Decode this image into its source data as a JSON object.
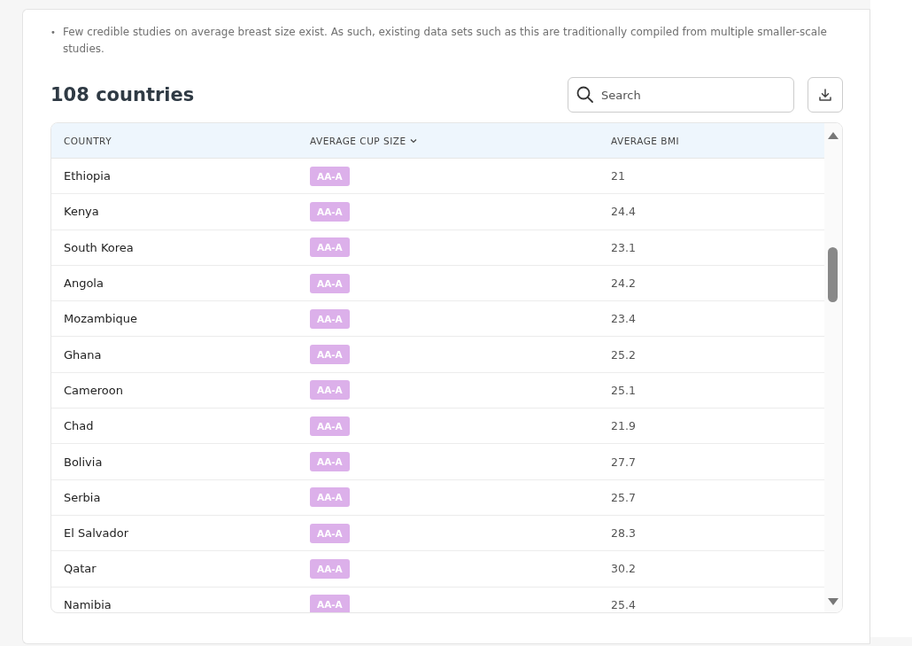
{
  "notes": [
    {
      "bullet": "•",
      "text": "Few credible studies on average breast size exist. As such, existing data sets such as this are traditionally compiled from multiple smaller-scale studies."
    }
  ],
  "heading": "108 countries",
  "search": {
    "placeholder": "Search"
  },
  "table": {
    "columns": [
      {
        "label": "COUNTRY",
        "sorted": false
      },
      {
        "label": "AVERAGE CUP SIZE",
        "sorted": true
      },
      {
        "label": "AVERAGE BMI",
        "sorted": false
      }
    ],
    "rows": [
      {
        "country": "Ethiopia",
        "cup": "AA-A",
        "bmi": "21"
      },
      {
        "country": "Kenya",
        "cup": "AA-A",
        "bmi": "24.4"
      },
      {
        "country": "South Korea",
        "cup": "AA-A",
        "bmi": "23.1"
      },
      {
        "country": "Angola",
        "cup": "AA-A",
        "bmi": "24.2"
      },
      {
        "country": "Mozambique",
        "cup": "AA-A",
        "bmi": "23.4"
      },
      {
        "country": "Ghana",
        "cup": "AA-A",
        "bmi": "25.2"
      },
      {
        "country": "Cameroon",
        "cup": "AA-A",
        "bmi": "25.1"
      },
      {
        "country": "Chad",
        "cup": "AA-A",
        "bmi": "21.9"
      },
      {
        "country": "Bolivia",
        "cup": "AA-A",
        "bmi": "27.7"
      },
      {
        "country": "Serbia",
        "cup": "AA-A",
        "bmi": "25.7"
      },
      {
        "country": "El Salvador",
        "cup": "AA-A",
        "bmi": "28.3"
      },
      {
        "country": "Qatar",
        "cup": "AA-A",
        "bmi": "30.2"
      },
      {
        "country": "Namibia",
        "cup": "AA-A",
        "bmi": "25.4"
      }
    ]
  }
}
